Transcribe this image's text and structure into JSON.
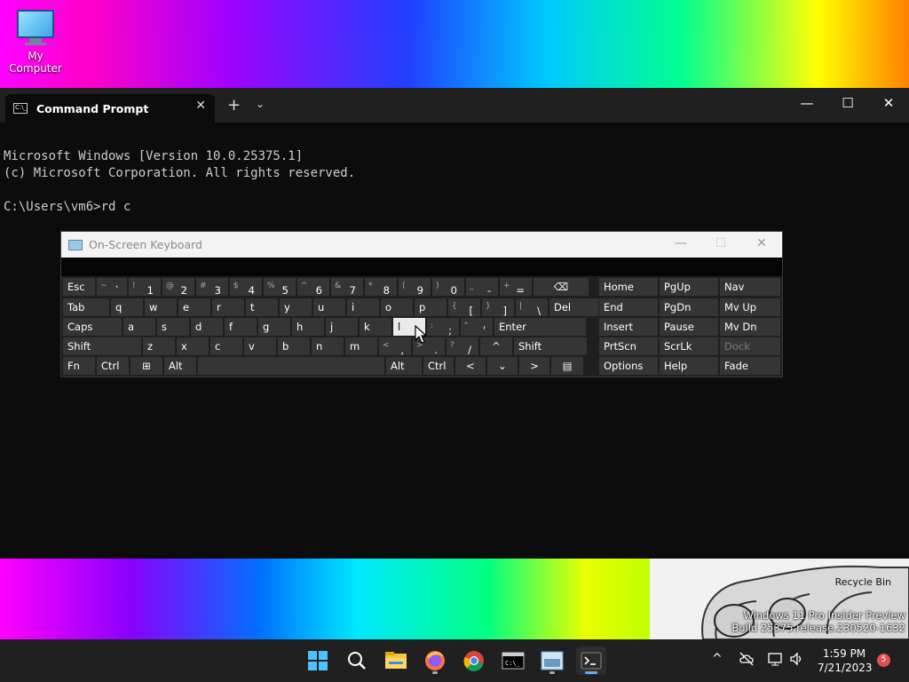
{
  "desktop": {
    "icon_label": "My Computer",
    "recycle_bin": "Recycle Bin",
    "watermark_line1": "Windows 11 Pro Insider Preview",
    "watermark_line2": "Build 25375.release.230520-1632"
  },
  "terminal": {
    "tab_title": "Command Prompt",
    "tab_icon_text": "C:\\_",
    "lines": [
      "Microsoft Windows [Version 10.0.25375.1]",
      "(c) Microsoft Corporation. All rights reserved.",
      "",
      "C:\\Users\\vm6>rd c"
    ],
    "controls": {
      "minimize": "—",
      "maximize": "☐",
      "close": "✕",
      "new_tab": "+",
      "dropdown": "⌄",
      "tab_close": "✕"
    }
  },
  "osk": {
    "title": "On-Screen Keyboard",
    "controls": {
      "minimize": "—",
      "maximize": "☐",
      "close": "✕"
    },
    "rows": [
      [
        {
          "label": "Esc"
        },
        {
          "shift": "~",
          "main": "`"
        },
        {
          "shift": "!",
          "main": "1"
        },
        {
          "shift": "@",
          "main": "2"
        },
        {
          "shift": "#",
          "main": "3"
        },
        {
          "shift": "$",
          "main": "4"
        },
        {
          "shift": "%",
          "main": "5"
        },
        {
          "shift": "^",
          "main": "6"
        },
        {
          "shift": "&",
          "main": "7"
        },
        {
          "shift": "*",
          "main": "8"
        },
        {
          "shift": "(",
          "main": "9"
        },
        {
          "shift": ")",
          "main": "0"
        },
        {
          "shift": "_",
          "main": "-"
        },
        {
          "shift": "+",
          "main": "="
        },
        {
          "label": "⌫"
        }
      ],
      [
        {
          "label": "Tab"
        },
        {
          "label": "q"
        },
        {
          "label": "w"
        },
        {
          "label": "e"
        },
        {
          "label": "r"
        },
        {
          "label": "t"
        },
        {
          "label": "y"
        },
        {
          "label": "u"
        },
        {
          "label": "i"
        },
        {
          "label": "o"
        },
        {
          "label": "p"
        },
        {
          "shift": "{",
          "main": "["
        },
        {
          "shift": "}",
          "main": "]"
        },
        {
          "shift": "|",
          "main": "\\"
        },
        {
          "label": "Del"
        }
      ],
      [
        {
          "label": "Caps"
        },
        {
          "label": "a"
        },
        {
          "label": "s"
        },
        {
          "label": "d"
        },
        {
          "label": "f"
        },
        {
          "label": "g"
        },
        {
          "label": "h"
        },
        {
          "label": "j"
        },
        {
          "label": "k"
        },
        {
          "label": "l"
        },
        {
          "shift": ":",
          "main": ";"
        },
        {
          "shift": "\"",
          "main": "'"
        },
        {
          "label": "Enter"
        }
      ],
      [
        {
          "label": "Shift"
        },
        {
          "label": "z"
        },
        {
          "label": "x"
        },
        {
          "label": "c"
        },
        {
          "label": "v"
        },
        {
          "label": "b"
        },
        {
          "label": "n"
        },
        {
          "label": "m"
        },
        {
          "shift": "<",
          "main": ","
        },
        {
          "shift": ">",
          "main": "."
        },
        {
          "shift": "?",
          "main": "/"
        },
        {
          "label": "^"
        },
        {
          "label": "Shift"
        }
      ],
      [
        {
          "label": "Fn"
        },
        {
          "label": "Ctrl"
        },
        {
          "label": "⊞"
        },
        {
          "label": "Alt"
        },
        {
          "label": ""
        },
        {
          "label": "Alt"
        },
        {
          "label": "Ctrl"
        },
        {
          "label": "<"
        },
        {
          "label": "⌄"
        },
        {
          "label": ">"
        },
        {
          "label": "▤"
        }
      ]
    ],
    "nav": [
      [
        "Home",
        "PgUp",
        "Nav"
      ],
      [
        "End",
        "PgDn",
        "Mv Up"
      ],
      [
        "Insert",
        "Pause",
        "Mv Dn"
      ],
      [
        "PrtScn",
        "ScrLk",
        "Dock"
      ],
      [
        "Options",
        "Help",
        "Fade"
      ]
    ]
  },
  "taskbar": {
    "apps": [
      "start",
      "search",
      "file-explorer",
      "firefox",
      "chrome",
      "cmd",
      "osk",
      "terminal"
    ],
    "clock_time": "1:59 PM",
    "clock_date": "7/21/2023",
    "notification_count": "5",
    "tray": {
      "chevron": "^",
      "network": "⊟",
      "speaker": "🔈"
    }
  }
}
